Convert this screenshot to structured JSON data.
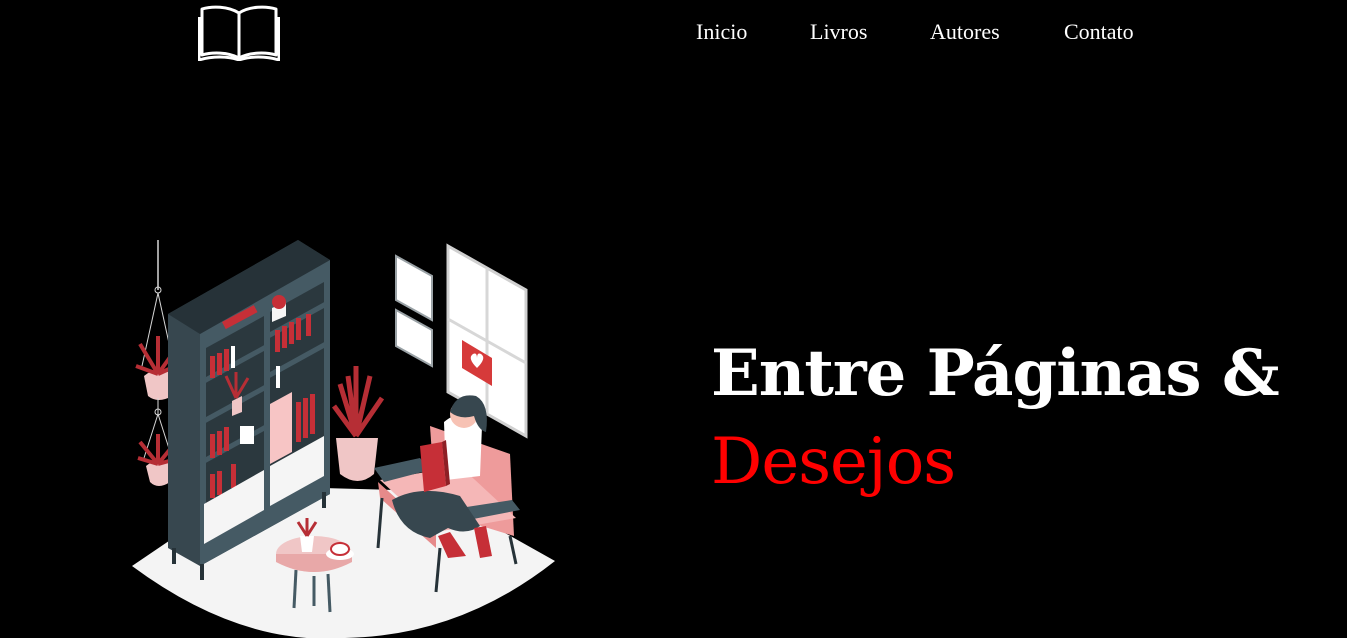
{
  "header": {
    "logo_icon": "open-book-icon",
    "nav": [
      {
        "label": "Inicio"
      },
      {
        "label": "Livros"
      },
      {
        "label": "Autores"
      },
      {
        "label": "Contato"
      }
    ]
  },
  "hero": {
    "title_line1": "Entre Páginas &",
    "title_line2": "Desejos",
    "accent_color": "#ff0000",
    "illustration": "woman-reading-in-armchair-by-bookshelf-illustration"
  },
  "colors": {
    "background": "#000000",
    "text": "#ffffff",
    "accent": "#ff0000"
  }
}
